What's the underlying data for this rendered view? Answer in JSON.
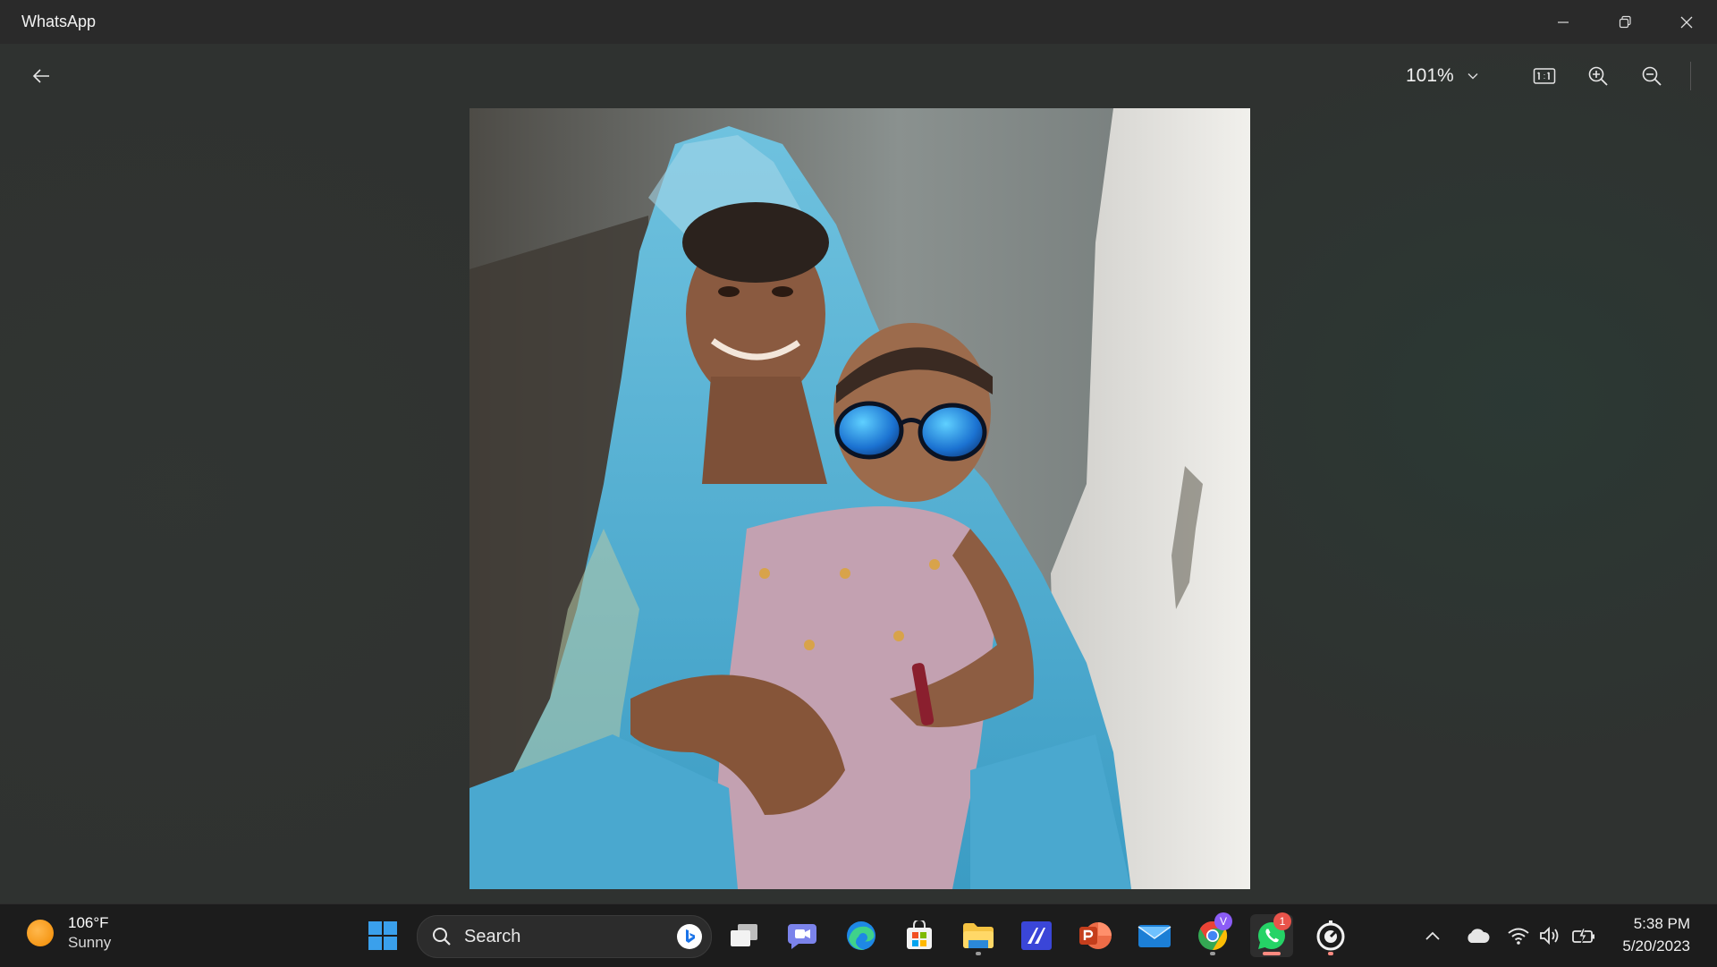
{
  "window": {
    "title": "WhatsApp",
    "controls": [
      "minimize-icon",
      "restore-icon",
      "close-icon"
    ]
  },
  "viewer": {
    "zoom": "101%",
    "toolbar_icons": [
      "back-arrow-icon",
      "chevron-down-icon",
      "actual-size-icon",
      "zoom-in-icon",
      "zoom-out-icon"
    ],
    "photo": {
      "description_icon": "photo-image",
      "colors": {
        "saree": "#4fb0d2",
        "wall_gray": "#7c8383",
        "wall_white": "#e7e6e0",
        "child_outfit": "#c8a4b2",
        "sunglass_lens": "#1d7fd8"
      }
    }
  },
  "taskbar": {
    "weather": {
      "temperature": "106°F",
      "condition": "Sunny",
      "icon": "sun-icon"
    },
    "search": {
      "label": "Search",
      "icon": "search-icon",
      "badge_icon": "bing-icon"
    },
    "apps": [
      {
        "name": "start",
        "icon": "windows-logo-icon"
      },
      {
        "name": "task-view",
        "icon": "task-view-icon"
      },
      {
        "name": "teams-chat",
        "icon": "chat-icon"
      },
      {
        "name": "edge",
        "icon": "edge-icon"
      },
      {
        "name": "store",
        "icon": "store-icon"
      },
      {
        "name": "file-explorer",
        "icon": "folder-icon"
      },
      {
        "name": "visual-studio",
        "icon": "vs-icon"
      },
      {
        "name": "powerpoint",
        "icon": "powerpoint-icon"
      },
      {
        "name": "mail",
        "icon": "mail-icon"
      },
      {
        "name": "chrome",
        "icon": "chrome-icon",
        "badge": "V"
      },
      {
        "name": "whatsapp",
        "icon": "whatsapp-icon",
        "badge": "1"
      },
      {
        "name": "clock-app",
        "icon": "clock-app-icon"
      }
    ],
    "tray": {
      "icons": [
        "chevron-up-icon",
        "onedrive-icon",
        "wifi-icon",
        "volume-icon",
        "battery-icon"
      ],
      "time": "5:38 PM",
      "date": "5/20/2023"
    },
    "accent_colors": {
      "whatsapp_green": "#25d366",
      "badge_red": "#e8534a",
      "badge_purple": "#8b5cf6"
    }
  }
}
